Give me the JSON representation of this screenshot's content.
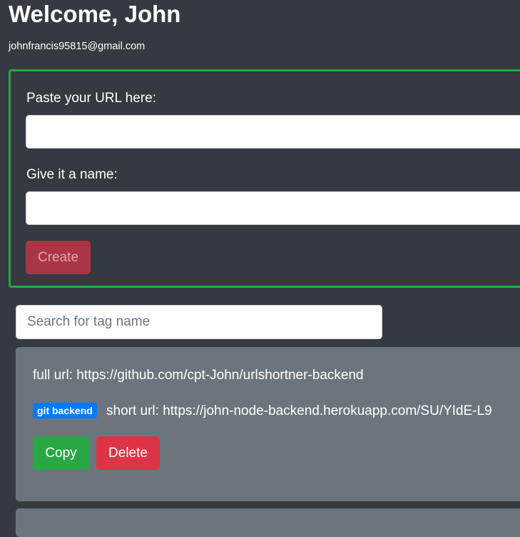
{
  "header": {
    "welcome": "Welcome, John",
    "email": "johnfrancis95815@gmail.com"
  },
  "form": {
    "url_label": "Paste your URL here:",
    "url_value": "",
    "name_label": "Give it a name:",
    "name_value": "",
    "create_label": "Create"
  },
  "search": {
    "placeholder": "Search for tag name"
  },
  "links": [
    {
      "full_url": "full url: https://github.com/cpt-John/urlshortner-backend",
      "tag": "git backend",
      "short_url": "short url: https://john-node-backend.herokuapp.com/SU/YIdE-L9",
      "copy_label": "Copy",
      "delete_label": "Delete"
    }
  ],
  "colors": {
    "background": "#343a40",
    "form_border": "#28a745",
    "create_button": "#a93545",
    "card": "#6c757d",
    "tag_badge": "#007bff",
    "copy_button": "#28a745",
    "delete_button": "#dc3545"
  }
}
